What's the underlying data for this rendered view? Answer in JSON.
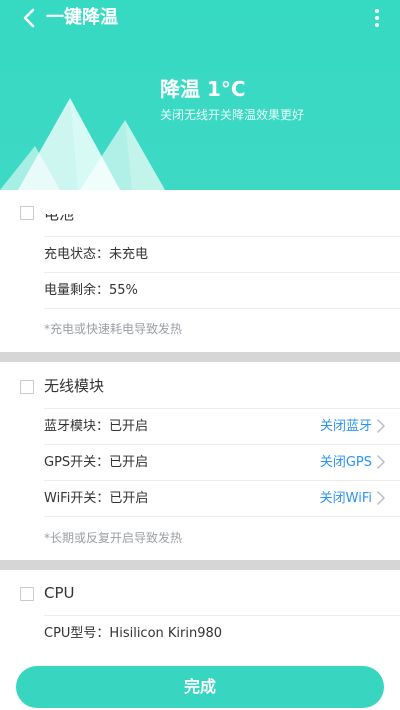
{
  "header": {
    "title": "一键降温",
    "temp_text": "降温 1°C",
    "hint": "关闭无线开关降温效果更好"
  },
  "battery": {
    "section_title": "电池",
    "rows": [
      {
        "label": "充电状态：未充电"
      },
      {
        "label": "电量剩余：55%"
      }
    ],
    "note": "*充电或快速耗电导致发热"
  },
  "wireless": {
    "section_title": "无线模块",
    "rows": [
      {
        "label": "蓝牙模块：已开启",
        "action": "关闭蓝牙"
      },
      {
        "label": "GPS开关：已开启",
        "action": "关闭GPS"
      },
      {
        "label": "WiFi开关：已开启",
        "action": "关闭WiFi"
      }
    ],
    "note": "*长期或反复开启导致发热"
  },
  "cpu": {
    "section_title": "CPU",
    "rows": [
      {
        "label": "CPU型号：Hisilicon Kirin980"
      }
    ]
  },
  "footer": {
    "done_label": "完成"
  },
  "colors": {
    "accent": "#38d5c0",
    "link": "#2a93f7"
  }
}
